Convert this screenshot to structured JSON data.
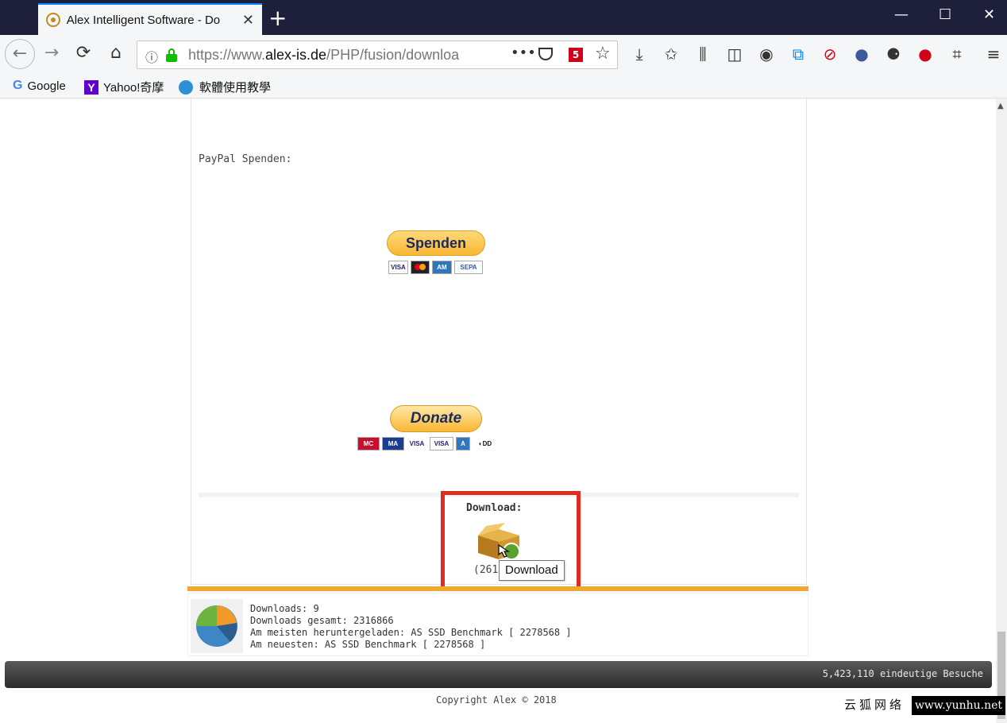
{
  "browser": {
    "tab_title": "Alex Intelligent Software - Do",
    "tab_close": "✕",
    "new_tab": "+",
    "minimize": "—",
    "maximize": "☐",
    "close": "✕",
    "url_prefix": "https://www.",
    "url_domain": "alex-is.de",
    "url_path": "/PHP/fusion/downloa",
    "more_actions": "•••",
    "ext_badge": "5",
    "bookmarks": [
      {
        "icon": "google-icon",
        "label": "Google"
      },
      {
        "icon": "yahoo-icon",
        "label": "Yahoo!奇摩"
      },
      {
        "icon": "gear-icon",
        "label": "軟體使用教學"
      }
    ]
  },
  "page": {
    "paypal_label": "PayPal Spenden:",
    "spenden_button": "Spenden",
    "donate_button": "Donate",
    "download_label": "Download:",
    "download_count": "(261",
    "tooltip": "Download",
    "stats": {
      "downloads": "Downloads: 9",
      "downloads_total": "Downloads gesamt: 2316866",
      "most_downloaded": "Am meisten heruntergeladen: AS SSD Benchmark [ 2278568 ]",
      "newest": "Am neuesten: AS SSD Benchmark [ 2278568 ]"
    },
    "visits": "5,423,110 eindeutige Besuche",
    "copyright": "Copyright Alex © 2018"
  },
  "watermark": {
    "cn": "云狐网络",
    "url": "www.yunhu.net"
  },
  "colors": {
    "titlebar": "#1d1f3b",
    "highlight": "#e02b20",
    "orange_bar": "#f0a830",
    "paypal_yellow": "#f7b733"
  }
}
